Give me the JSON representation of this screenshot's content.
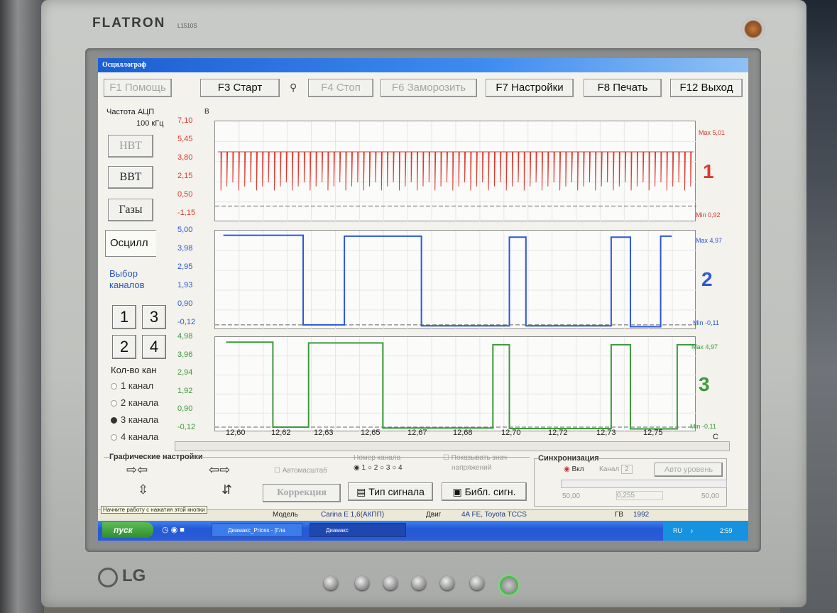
{
  "monitor": {
    "brand": "FLATRON",
    "model": "L1510S",
    "maker": "LG"
  },
  "window": {
    "title": "Осциллограф"
  },
  "toolbar": {
    "help": "F1 Помощь",
    "start": "F3 Старт",
    "stop": "F4 Стоп",
    "freeze": "F6 Заморозить",
    "settings": "F7 Настройки",
    "print": "F8 Печать",
    "exit": "F12 Выход"
  },
  "left_panel": {
    "adc_label": "Частота АЦП",
    "adc_value": "100 кГц",
    "btn_nvt": "НВТ",
    "btn_vvt": "ВВТ",
    "btn_gases": "Газы",
    "tab_oscill": "Осцилл",
    "channel_select_1": "Выбор",
    "channel_select_2": "каналов",
    "channels": [
      "1",
      "3",
      "2",
      "4"
    ],
    "count_label": "Кол-во кан",
    "radio_options": [
      "1 канал",
      "2 канала",
      "3 канала",
      "4 канала"
    ],
    "radio_selected": 2
  },
  "chart_data": [
    {
      "type": "line",
      "channel": "1",
      "unit": "В",
      "color": "#e0382d",
      "yticks": [
        "7,10",
        "5,45",
        "3,80",
        "2,15",
        "0,50",
        "-1,15"
      ],
      "ylim": [
        -1.15,
        7.1
      ],
      "max_label": "Max 5,01",
      "min_label": "Min 0,92",
      "high": 4.7,
      "low": 1.35,
      "spikes_count": 80
    },
    {
      "type": "line",
      "channel": "2",
      "color": "#2d58d6",
      "yticks": [
        "5,00",
        "3,98",
        "2,95",
        "1,93",
        "0,90",
        "-0,12"
      ],
      "ylim": [
        -0.12,
        5.0
      ],
      "max_label": "Max 4,97",
      "min_label": "Min -0,11",
      "x": [
        12.593,
        12.622,
        12.622,
        12.637,
        12.637,
        12.665,
        12.665,
        12.697,
        12.697,
        12.703,
        12.703,
        12.734,
        12.734,
        12.741,
        12.741,
        12.752,
        12.752,
        12.756
      ],
      "y": [
        4.9,
        4.9,
        0.0,
        0.0,
        4.85,
        4.85,
        -0.05,
        -0.05,
        4.8,
        4.8,
        -0.05,
        -0.05,
        4.8,
        4.8,
        -0.1,
        -0.1,
        4.85,
        4.85
      ]
    },
    {
      "type": "line",
      "channel": "3",
      "color": "#3c9a3c",
      "yticks": [
        "4,98",
        "3,96",
        "2,94",
        "1,92",
        "0,90",
        "-0,12"
      ],
      "ylim": [
        -0.12,
        4.98
      ],
      "max_label": "Max 4,97",
      "min_label": "Min -0,11",
      "x": [
        12.594,
        12.611,
        12.611,
        12.624,
        12.624,
        12.651,
        12.651,
        12.691,
        12.691,
        12.697,
        12.697,
        12.734,
        12.734,
        12.741,
        12.741,
        12.758,
        12.758,
        12.766
      ],
      "y": [
        4.85,
        4.85,
        0.0,
        0.0,
        4.8,
        4.8,
        -0.05,
        -0.05,
        4.7,
        4.7,
        -0.08,
        -0.08,
        4.7,
        4.7,
        -0.1,
        -0.1,
        4.7,
        4.7
      ],
      "xticks": [
        "12,60",
        "12,62",
        "12,63",
        "12,65",
        "12,67",
        "12,68",
        "12,70",
        "12,72",
        "12,73",
        "12,75"
      ],
      "xunit": "С"
    }
  ],
  "bottom_panel": {
    "graphic_settings": "Графические настройки",
    "autoscale": "Автомасштаб",
    "channel_number": "Номер канала",
    "channel_radios": [
      "1",
      "2",
      "3",
      "4"
    ],
    "show_values_1": "Показывать знач",
    "show_values_2": "напряжений",
    "sync": "Синхронизация",
    "sync_on": "Вкл",
    "sync_channel": "Канал",
    "sync_channel_value": "2",
    "auto_level": "Авто уровень",
    "correction": "Коррекция",
    "signal_type": "Тип сигнала",
    "signal_lib": "Библ. сигн.",
    "field_left": "50,00",
    "field_mid": "0,255",
    "field_right": "50,00"
  },
  "status": {
    "hint": "Начните работу с нажатия этой кнопки",
    "model_label": "Модель",
    "model_value": "Carina E 1,6(АКПП)",
    "engine_label": "Двиг",
    "engine_value": "4A FE, Toyota TCCS",
    "year_label": "ГВ",
    "year_value": "1992"
  },
  "taskbar": {
    "start": "пуск",
    "item1": "Диамакс_Prices - [Гла",
    "item2": "Диамакс",
    "lang": "RU",
    "clock": "2:59"
  }
}
